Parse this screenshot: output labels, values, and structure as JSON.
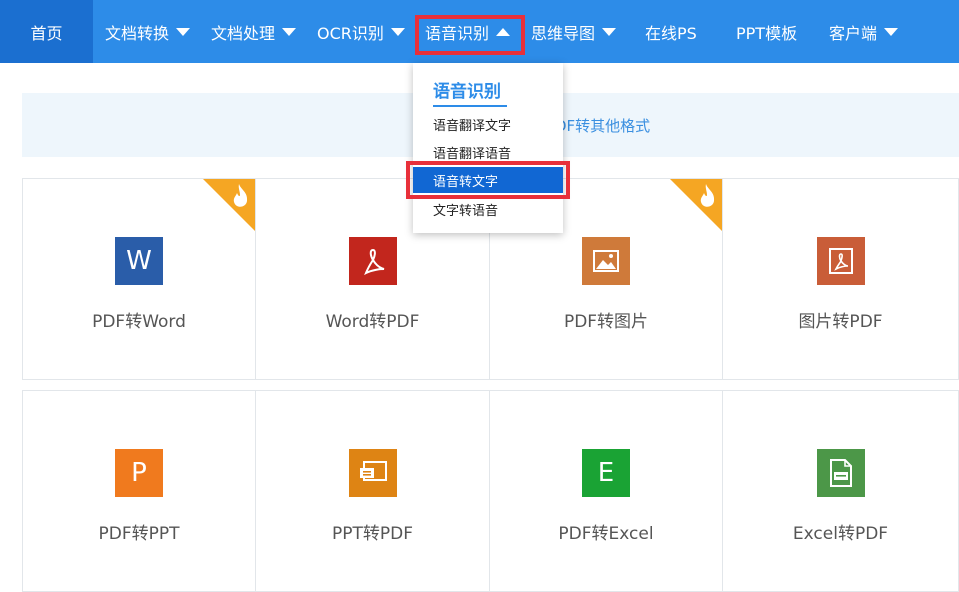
{
  "nav": {
    "items": [
      {
        "label": "首页",
        "dropdown": false
      },
      {
        "label": "文档转换",
        "dropdown": true
      },
      {
        "label": "文档处理",
        "dropdown": true
      },
      {
        "label": "OCR识别",
        "dropdown": true
      },
      {
        "label": "语音识别",
        "dropdown": true,
        "open": true
      },
      {
        "label": "思维导图",
        "dropdown": true
      },
      {
        "label": "在线PS",
        "dropdown": false
      },
      {
        "label": "PPT模板",
        "dropdown": false
      },
      {
        "label": "客户端",
        "dropdown": true
      }
    ]
  },
  "strip": {
    "text": "DF转其他格式"
  },
  "dropdown": {
    "title": "语音识别",
    "items": [
      "语音翻译文字",
      "语音翻译语音",
      "语音转文字",
      "文字转语音"
    ],
    "active_index": 2
  },
  "tools": {
    "row1": [
      {
        "label": "PDF转Word",
        "icon": "word-icon",
        "glyph": "W",
        "color": "#2a5da9",
        "hot": true
      },
      {
        "label": "Word转PDF",
        "icon": "pdf-icon",
        "glyph": "",
        "color": "#c2261d",
        "hot": false
      },
      {
        "label": "PDF转图片",
        "icon": "image-icon",
        "glyph": "",
        "color": "#cf7a3a",
        "hot": true
      },
      {
        "label": "图片转PDF",
        "icon": "pdf-icon",
        "glyph": "",
        "color": "#c95d38",
        "hot": false
      }
    ],
    "row2": [
      {
        "label": "PDF转PPT",
        "icon": "ppt-icon",
        "glyph": "P",
        "color": "#f07a1e",
        "hot": false
      },
      {
        "label": "PPT转PDF",
        "icon": "ppt-pdf-icon",
        "glyph": "",
        "color": "#de8414",
        "hot": false
      },
      {
        "label": "PDF转Excel",
        "icon": "excel-icon",
        "glyph": "E",
        "color": "#1aa334",
        "hot": false
      },
      {
        "label": "Excel转PDF",
        "icon": "excel-pdf-icon",
        "glyph": "",
        "color": "#4c9748",
        "hot": false
      }
    ]
  },
  "colors": {
    "nav_bg": "#2d8ce8",
    "nav_active": "#1b6fd0",
    "highlight": "#e8303a",
    "hot_badge": "#f5a623"
  }
}
